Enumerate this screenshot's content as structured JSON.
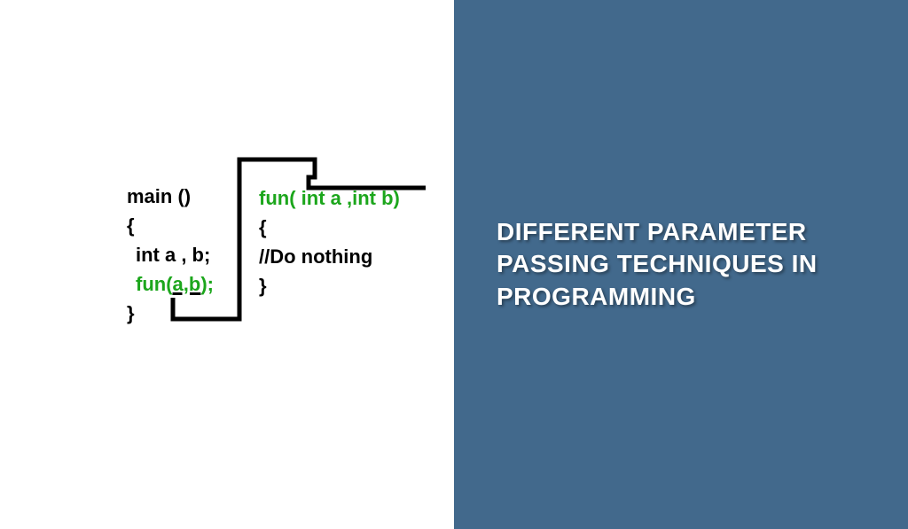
{
  "title": "DIFFERENT PARAMETER PASSING TECHNIQUES IN PROGRAMMING",
  "colors": {
    "accent_bg": "#42698c",
    "code_highlight": "#1ca61c"
  },
  "code": {
    "main": {
      "line1": "main ()",
      "line2": "{",
      "line3": "int a , b;",
      "line4_fun": "fun(",
      "line4_args": "a,b",
      "line4_close": ");",
      "line5": "}"
    },
    "fun": {
      "line1_fun": "fun( ",
      "line1_args": "int a ,int b)",
      "line2": "{",
      "line3": "//Do nothing",
      "line4": "}"
    }
  }
}
